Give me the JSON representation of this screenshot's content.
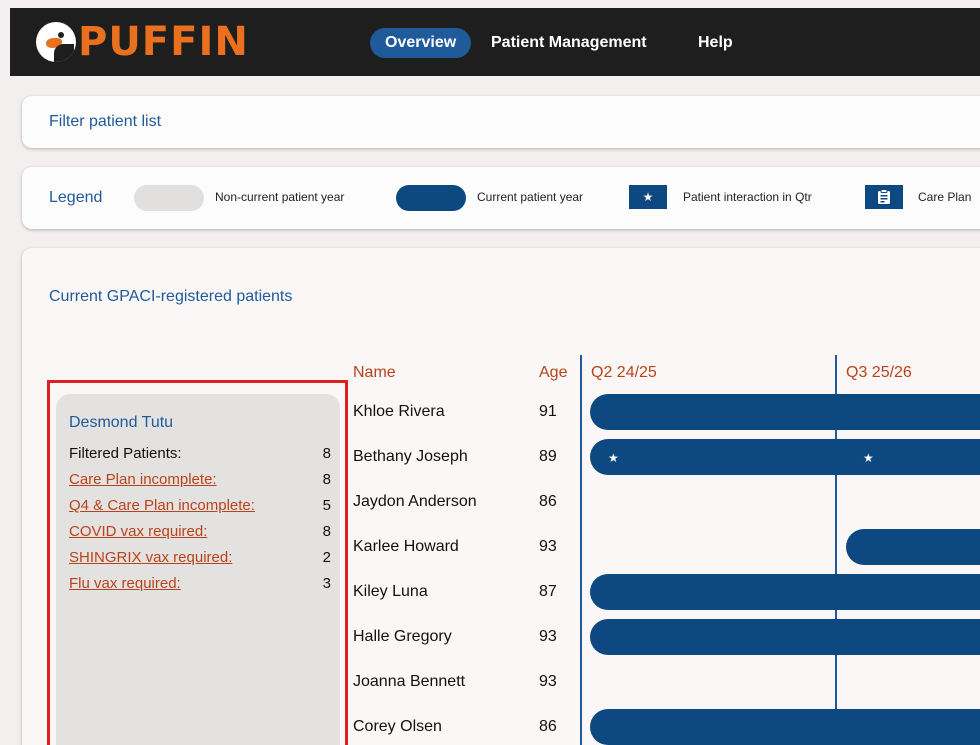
{
  "app": {
    "name": "PUFFIN"
  },
  "nav": {
    "items": [
      "Overview",
      "Patient Management",
      "Help"
    ]
  },
  "filter": {
    "title": "Filter patient list"
  },
  "legend": {
    "title": "Legend",
    "items": [
      "Non-current patient year",
      "Current patient year",
      "Patient interaction in Qtr",
      "Care Plan"
    ],
    "star_glyph": "★",
    "colors": {
      "non_current": "#e2e0df",
      "current": "#0d4880"
    }
  },
  "main": {
    "title": "Current GPACI-registered patients",
    "summary": {
      "name": "Desmond Tutu",
      "rows": [
        {
          "label": "Filtered Patients:",
          "count": "8"
        },
        {
          "label": "Care Plan incomplete:",
          "count": "8"
        },
        {
          "label": "Q4 & Care Plan incomplete:",
          "count": "5"
        },
        {
          "label": "COVID vax required:",
          "count": "8"
        },
        {
          "label": "SHINGRIX vax required:",
          "count": "2"
        },
        {
          "label": "Flu vax required:",
          "count": "3"
        }
      ]
    },
    "table": {
      "headers": {
        "name": "Name",
        "age": "Age",
        "q1": "Q2 24/25",
        "q2": "Q3 25/26"
      },
      "rows": [
        {
          "name": "Khloe Rivera",
          "age": "91"
        },
        {
          "name": "Bethany Joseph",
          "age": "89"
        },
        {
          "name": "Jaydon Anderson",
          "age": "86"
        },
        {
          "name": "Karlee Howard",
          "age": "93"
        },
        {
          "name": "Kiley Luna",
          "age": "87"
        },
        {
          "name": "Halle Gregory",
          "age": "93"
        },
        {
          "name": "Joanna Bennett",
          "age": "93"
        },
        {
          "name": "Corey Olsen",
          "age": "86"
        }
      ]
    }
  }
}
